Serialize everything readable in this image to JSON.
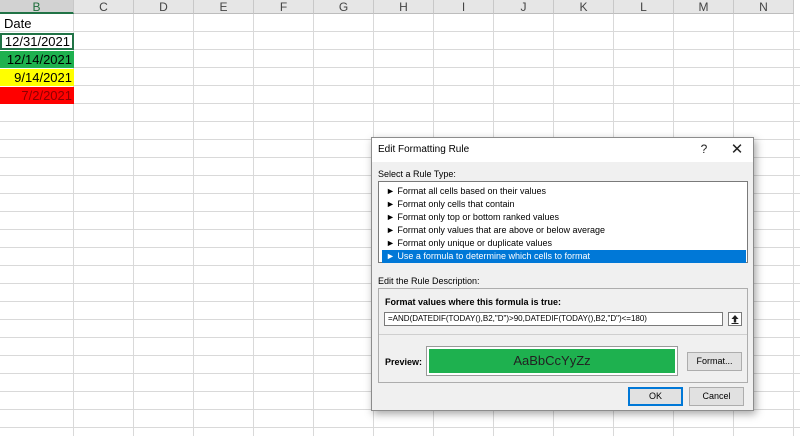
{
  "sheet": {
    "columns": [
      "B",
      "C",
      "D",
      "E",
      "F",
      "G",
      "H",
      "I",
      "J",
      "K",
      "L",
      "M",
      "N"
    ],
    "selected_column": "B",
    "header_cell": "Date",
    "dates": [
      {
        "value": "12/31/2021",
        "fill": "#ffffff",
        "text_color": "#000000"
      },
      {
        "value": "12/14/2021",
        "fill": "#1eb14f",
        "text_color": "#000000"
      },
      {
        "value": "9/14/2021",
        "fill": "#ffff00",
        "text_color": "#000000"
      },
      {
        "value": "7/2/2021",
        "fill": "#ff0000",
        "text_color": "#8b0000"
      }
    ]
  },
  "dialog": {
    "title": "Edit Formatting Rule",
    "help_label": "?",
    "close_label": "✕",
    "rule_type_label": "Select a Rule Type:",
    "rule_types": [
      "► Format all cells based on their values",
      "► Format only cells that contain",
      "► Format only top or bottom ranked values",
      "► Format only values that are above or below average",
      "► Format only unique or duplicate values",
      "► Use a formula to determine which cells to format"
    ],
    "selected_rule_index": 5,
    "description_label": "Edit the Rule Description:",
    "formula_label": "Format values where this formula is true:",
    "formula_value": "=AND(DATEDIF(TODAY(),B2,\"D\")>90,DATEDIF(TODAY(),B2,\"D\")<=180)",
    "preview_label": "Preview:",
    "preview_text": "AaBbCcYyZz",
    "preview_color": "#1eb14f",
    "format_button": "Format...",
    "ok_button": "OK",
    "cancel_button": "Cancel"
  }
}
